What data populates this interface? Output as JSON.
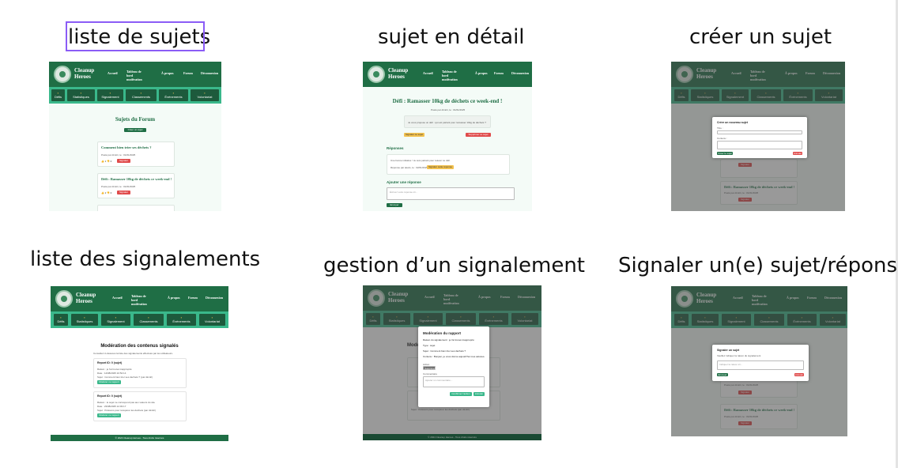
{
  "captions": {
    "list_topics": "liste de sujets",
    "topic_detail": "sujet en détail",
    "create_topic": "créer un sujet",
    "report_list": "liste des signalements",
    "report_manage": "gestion d’un signalement",
    "report_submit": "Signaler un(e) sujet/réponse"
  },
  "app": {
    "name_line1": "Cleanup",
    "name_line2": "Heroes",
    "nav": [
      "Accueil",
      "Tableau de bord modération",
      "À propos",
      "Forum",
      "Déconnexion"
    ],
    "nav_short": [
      "Accueil",
      "Tableau de bord",
      "À",
      "Forum",
      "Déconnexion"
    ],
    "categories": [
      "Défis",
      "Statistiques",
      "Signalement",
      "Classements",
      "Événements",
      "Volontariat"
    ],
    "footer": "© 2024 Cleanup Heroes - Tous droits réservés"
  },
  "forum": {
    "title": "Sujets du Forum",
    "create_button": "Créer un sujet",
    "topics": [
      {
        "title": "Comment bien trier ses déchets ?",
        "meta": "Posté par dimitri, le : 01/01/2025",
        "report": "Signaler"
      },
      {
        "title": "Défi : Ramasser 10kg de déchets ce week-end !",
        "meta": "Posté par dimitri, le : 01/01/2025",
        "report": "Signaler"
      }
    ]
  },
  "detail": {
    "title": "Défi : Ramasser 10kg de déchets ce week-end !",
    "meta": "Posté par dimitri, le : 01/01/2025",
    "body": "Je vous propose un défi : qui est partant pour ramasser 10kg de déchets ?",
    "report_topic": "Signaler ce sujet",
    "delete_topic": "Supprimer ce sujet",
    "replies_heading": "Réponses",
    "reply_text": "Une bonne initiative ! Je suis partant pour relever ce défi.",
    "reply_meta": "Réponse par alexis, le : 02/01/2025",
    "report_reply": "Signaler cette réponse",
    "add_reply_heading": "Ajouter une réponse",
    "reply_placeholder": "Écrivez votre réponse ici...",
    "send": "Envoyer"
  },
  "create": {
    "modal_title": "Créer un nouveau sujet",
    "title_label": "Titre :",
    "content_label": "Contenu :",
    "submit": "Créer le sujet",
    "cancel": "Annuler"
  },
  "reports": {
    "title": "Modération des contenus signalés",
    "subtitle": "Consultez ci-dessous la liste des signalements effectués par les utilisateurs.",
    "items": [
      {
        "heading": "Report ID: 0 (sujet)",
        "reason": "Raison : je l'ai trouvé inapproprié",
        "date": "Date : 14/08/2025 10:52:14",
        "subject": "Sujet : Comment bien trier ses déchets ? (par dimitri)",
        "action": "Modérer ce rapport"
      },
      {
        "heading": "Report ID: 0 (sujet)",
        "reason": "Raison : le sujet ne correspond pas aux valeurs du site",
        "date": "Date : 23/08/2025 12:03:17",
        "subject": "Sujet : Poissons pour récupérer les déchets (par dimitri)",
        "action": "Modérer ce rapport"
      }
    ]
  },
  "moderation": {
    "modal_title": "Modération du rapport",
    "reason": "Raison du signalement : je l'ai trouvé inapproprié",
    "type": "Type : sujet",
    "subject": "Sujet : Comment bien trier ses déchets ?",
    "content": "Contenu : Bonjour, je vous donne aujourd'hui mes astuces.",
    "action_label": "Action",
    "action_value": "Supprimer",
    "comment_label": "Commentaire",
    "comment_placeholder": "Ajouter un commentaire...",
    "confirm": "Confirmer l'action",
    "cancel": "Annuler"
  },
  "report_form": {
    "modal_title": "Signaler un sujet",
    "hint": "Veuillez indiquer la raison du signalement",
    "placeholder": "Indiquer la raison ici...",
    "send": "Envoyer",
    "cancel": "Annuler"
  }
}
